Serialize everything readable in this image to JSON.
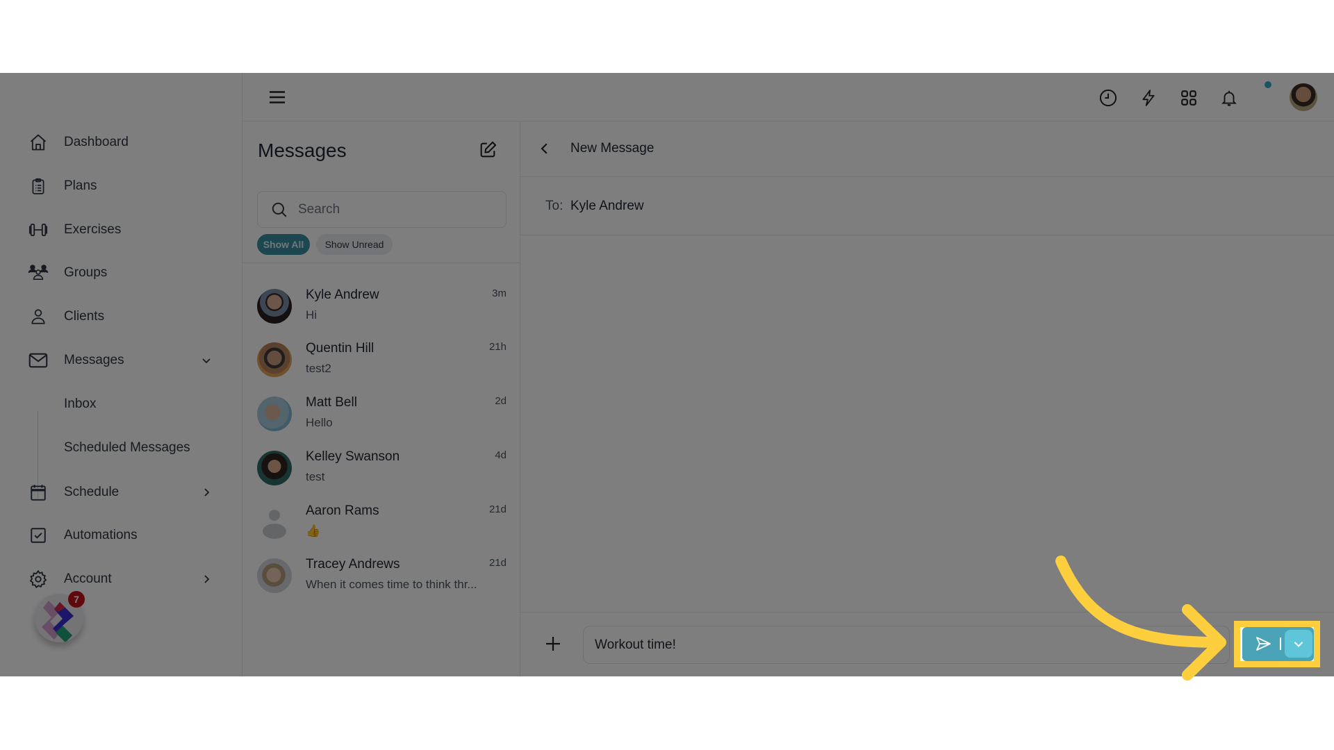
{
  "sidebar": {
    "items": [
      {
        "label": "Dashboard",
        "icon": "home-icon"
      },
      {
        "label": "Plans",
        "icon": "clipboard-icon"
      },
      {
        "label": "Exercises",
        "icon": "dumbbell-icon"
      },
      {
        "label": "Groups",
        "icon": "users-icon"
      },
      {
        "label": "Clients",
        "icon": "user-icon"
      },
      {
        "label": "Messages",
        "icon": "mail-icon",
        "expanded": true
      },
      {
        "label": "Schedule",
        "icon": "calendar-icon"
      },
      {
        "label": "Automations",
        "icon": "checkbox-icon"
      },
      {
        "label": "Account",
        "icon": "gear-icon"
      }
    ],
    "messages_sub": [
      {
        "label": "Inbox"
      },
      {
        "label": "Scheduled Messages"
      }
    ],
    "app_badge": "7"
  },
  "topbar": {
    "icons": [
      "history-icon",
      "lightning-icon",
      "apps-grid-icon",
      "bell-icon"
    ],
    "notification_dot_color": "#3aa7c0"
  },
  "conversations": {
    "title": "Messages",
    "search_placeholder": "Search",
    "filters": {
      "all": "Show All",
      "unread": "Show Unread"
    },
    "items": [
      {
        "name": "Kyle Andrew",
        "preview": "Hi",
        "time": "3m"
      },
      {
        "name": "Quentin Hill",
        "preview": "test2",
        "time": "21h"
      },
      {
        "name": "Matt Bell",
        "preview": "Hello",
        "time": "2d"
      },
      {
        "name": "Kelley Swanson",
        "preview": "test",
        "time": "4d"
      },
      {
        "name": "Aaron Rams",
        "preview": "👍",
        "time": "21d"
      },
      {
        "name": "Tracey Andrews",
        "preview": "When it comes time to think thr...",
        "time": "21d"
      }
    ]
  },
  "pane": {
    "title": "New Message",
    "to_label": "To:",
    "to_value": "Kyle Andrew",
    "message_value": "Workout time!"
  },
  "colors": {
    "accent": "#3f93a6",
    "accent_light": "#55b8cc",
    "annotation": "#fdcf3f"
  }
}
